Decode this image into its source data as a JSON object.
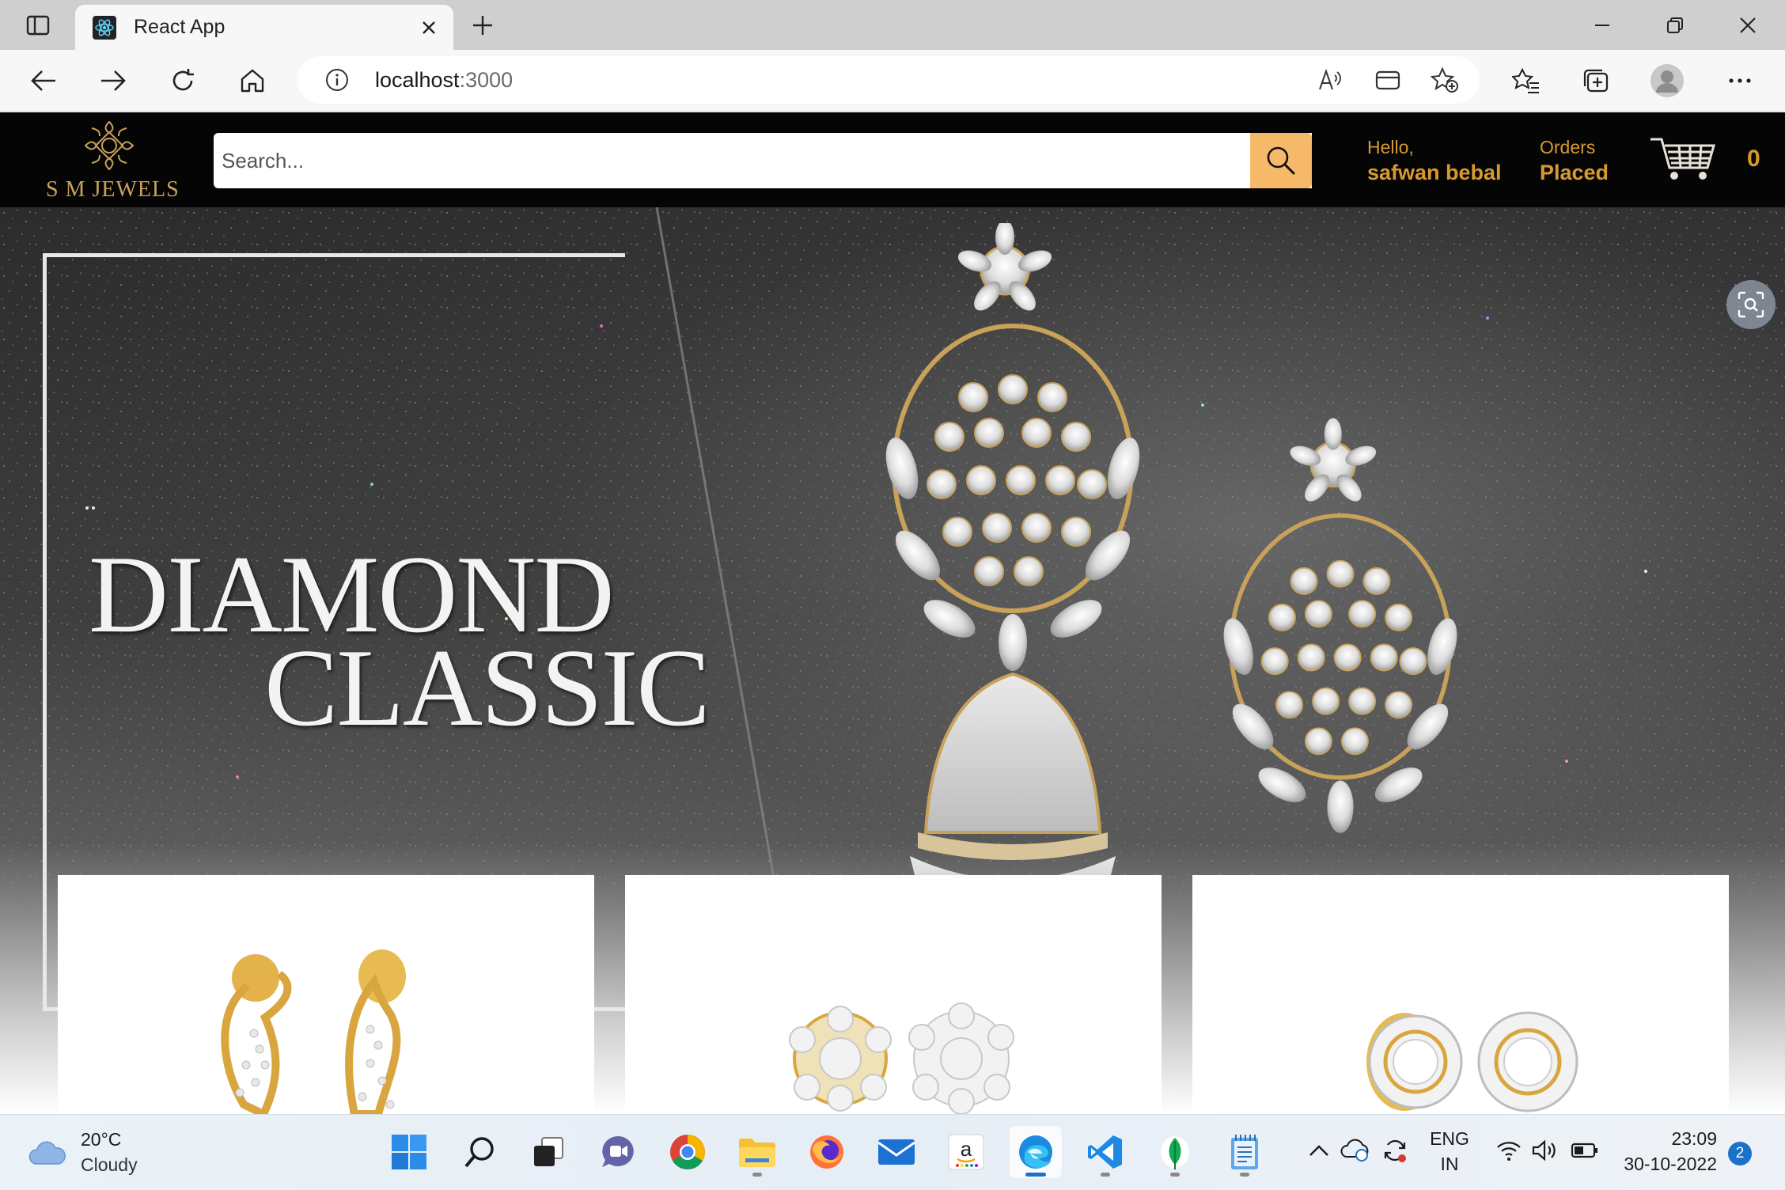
{
  "browser": {
    "tab": {
      "title": "React App"
    },
    "address": {
      "host": "localhost",
      "port": ":3000"
    }
  },
  "site": {
    "brand": "S M JEWELS",
    "search": {
      "placeholder": "Search..."
    },
    "account": {
      "greeting": "Hello,",
      "name": "safwan bebal"
    },
    "orders": {
      "line1": "Orders",
      "line2": "Placed"
    },
    "cart": {
      "count": "0"
    },
    "hero": {
      "line1": "DIAMOND",
      "line2": "CLASSIC"
    },
    "products": [
      {
        "icon": "gold-drop-earrings"
      },
      {
        "icon": "diamond-flower-stud-earrings"
      },
      {
        "icon": "round-halo-stud-earrings"
      }
    ]
  },
  "colors": {
    "brand_gold": "#d89a30",
    "search_button": "#f6b96a",
    "header_bg": "#050505"
  },
  "taskbar": {
    "weather": {
      "temp": "20°C",
      "condition": "Cloudy"
    },
    "language": {
      "line1": "ENG",
      "line2": "IN"
    },
    "clock": {
      "time": "23:09",
      "date": "30-10-2022"
    },
    "notifications": "2"
  }
}
